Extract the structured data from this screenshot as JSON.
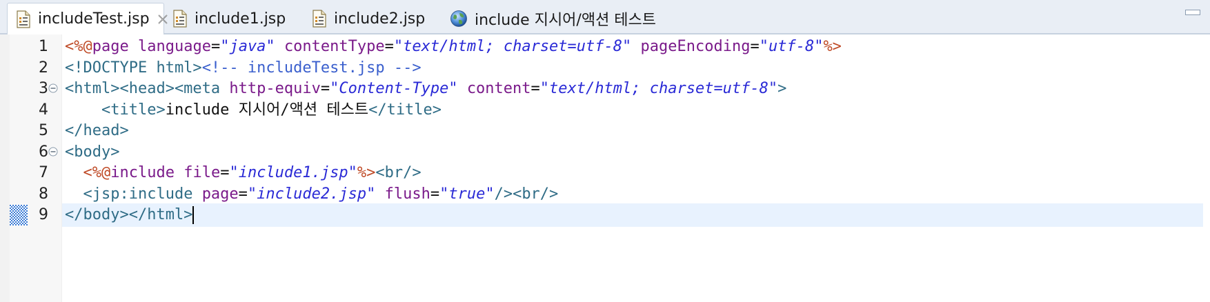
{
  "tabs": [
    {
      "label": "includeTest.jsp",
      "active": true,
      "icon": "jsp-file-icon",
      "closable": true
    },
    {
      "label": "include1.jsp",
      "active": false,
      "icon": "jsp-file-icon"
    },
    {
      "label": "include2.jsp",
      "active": false,
      "icon": "jsp-file-icon"
    },
    {
      "label": "include 지시어/액션 테스트",
      "active": false,
      "icon": "globe-icon"
    }
  ],
  "editor": {
    "current_line": 9,
    "lines": [
      {
        "no": "1",
        "tokens": [
          {
            "c": "d",
            "t": "<%@"
          },
          {
            "c": "a",
            "t": "page "
          },
          {
            "c": "a",
            "t": "language"
          },
          {
            "c": "p",
            "t": "="
          },
          {
            "c": "v",
            "t": "\"java\""
          },
          {
            "c": "x",
            "t": " "
          },
          {
            "c": "a",
            "t": "contentType"
          },
          {
            "c": "p",
            "t": "="
          },
          {
            "c": "v",
            "t": "\"text/html; charset=utf-8\""
          },
          {
            "c": "x",
            "t": " "
          },
          {
            "c": "a",
            "t": "pageEncoding"
          },
          {
            "c": "p",
            "t": "="
          },
          {
            "c": "v",
            "t": "\"utf-8\""
          },
          {
            "c": "d",
            "t": "%>"
          }
        ]
      },
      {
        "no": "2",
        "tokens": [
          {
            "c": "t",
            "t": "<!DOCTYPE html>"
          },
          {
            "c": "c",
            "t": "<!-- includeTest.jsp -->"
          }
        ]
      },
      {
        "no": "3",
        "fold": true,
        "tokens": [
          {
            "c": "t",
            "t": "<html><head><meta "
          },
          {
            "c": "a",
            "t": "http-equiv"
          },
          {
            "c": "p",
            "t": "="
          },
          {
            "c": "v",
            "t": "\"Content-Type\""
          },
          {
            "c": "x",
            "t": " "
          },
          {
            "c": "a",
            "t": "content"
          },
          {
            "c": "p",
            "t": "="
          },
          {
            "c": "v",
            "t": "\"text/html; charset=utf-8\""
          },
          {
            "c": "t",
            "t": ">"
          }
        ]
      },
      {
        "no": "4",
        "tokens": [
          {
            "c": "x",
            "t": "    "
          },
          {
            "c": "t",
            "t": "<title>"
          },
          {
            "c": "x",
            "t": "include 지시어/액션 테스트"
          },
          {
            "c": "t",
            "t": "</title>"
          }
        ]
      },
      {
        "no": "5",
        "tokens": [
          {
            "c": "t",
            "t": "</head>"
          }
        ]
      },
      {
        "no": "6",
        "fold": true,
        "tokens": [
          {
            "c": "t",
            "t": "<body>"
          }
        ]
      },
      {
        "no": "7",
        "tokens": [
          {
            "c": "x",
            "t": "  "
          },
          {
            "c": "d",
            "t": "<%@"
          },
          {
            "c": "a",
            "t": "include "
          },
          {
            "c": "a",
            "t": "file"
          },
          {
            "c": "p",
            "t": "="
          },
          {
            "c": "v",
            "t": "\"include1.jsp\""
          },
          {
            "c": "d",
            "t": "%>"
          },
          {
            "c": "t",
            "t": "<br/>"
          }
        ]
      },
      {
        "no": "8",
        "tokens": [
          {
            "c": "x",
            "t": "  "
          },
          {
            "c": "t",
            "t": "<jsp:include "
          },
          {
            "c": "a",
            "t": "page"
          },
          {
            "c": "p",
            "t": "="
          },
          {
            "c": "v",
            "t": "\"include2.jsp\""
          },
          {
            "c": "x",
            "t": " "
          },
          {
            "c": "a",
            "t": "flush"
          },
          {
            "c": "p",
            "t": "="
          },
          {
            "c": "v",
            "t": "\"true\""
          },
          {
            "c": "t",
            "t": "/><br/>"
          }
        ]
      },
      {
        "no": "9",
        "caret": true,
        "tokens": [
          {
            "c": "t",
            "t": "</body></html>"
          }
        ]
      }
    ]
  },
  "colors": {
    "tag": "#2f6c86",
    "directive": "#bf4a26",
    "attribute": "#7a1a8a",
    "value": "#2a2ad6",
    "comment": "#3a5fcd",
    "current_line_bg": "#e8f2fe"
  }
}
